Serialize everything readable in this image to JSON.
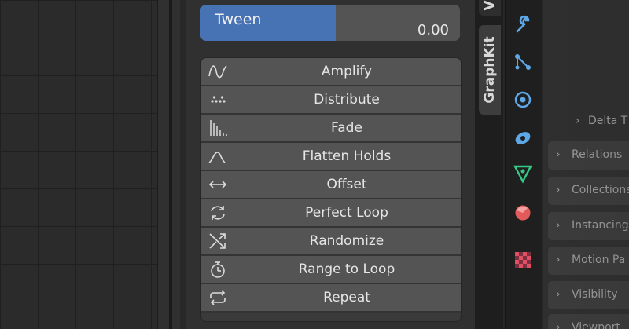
{
  "tween": {
    "label": "Tween",
    "value": "0.00",
    "fill_fraction": 0.52
  },
  "operators": [
    {
      "label": "Amplify",
      "icon": "amplify-icon"
    },
    {
      "label": "Distribute",
      "icon": "distribute-icon"
    },
    {
      "label": "Fade",
      "icon": "fade-icon"
    },
    {
      "label": "Flatten Holds",
      "icon": "flatten-holds-icon"
    },
    {
      "label": "Offset",
      "icon": "offset-icon"
    },
    {
      "label": "Perfect Loop",
      "icon": "perfect-loop-icon"
    },
    {
      "label": "Randomize",
      "icon": "randomize-icon"
    },
    {
      "label": "Range to Loop",
      "icon": "range-to-loop-icon"
    },
    {
      "label": "Repeat",
      "icon": "repeat-icon"
    }
  ],
  "tabs": {
    "active": "GraphKit",
    "partial": "V"
  },
  "properties_icons": [
    {
      "name": "tool-wrench-icon",
      "color": "#5ea8e8"
    },
    {
      "name": "object-constraint-icon",
      "color": "#5ea8e8"
    },
    {
      "name": "physics-icon",
      "color": "#5ea8e8"
    },
    {
      "name": "object-data-icon",
      "color": "#5ea8e8"
    },
    {
      "name": "mesh-data-icon",
      "color": "#36c987"
    },
    {
      "name": "material-icon",
      "color": "#e25a5a"
    },
    {
      "name": "texture-icon",
      "color": "#e04f62"
    }
  ],
  "properties_rows": {
    "sub": "Delta T",
    "items": [
      "Relations",
      "Collections",
      "Instancing",
      "Motion Pa",
      "Visibility",
      "Viewport"
    ]
  },
  "colors": {
    "accent": "#4772b3",
    "button": "#545454",
    "panel": "#303030",
    "text": "#e6e6e6"
  }
}
